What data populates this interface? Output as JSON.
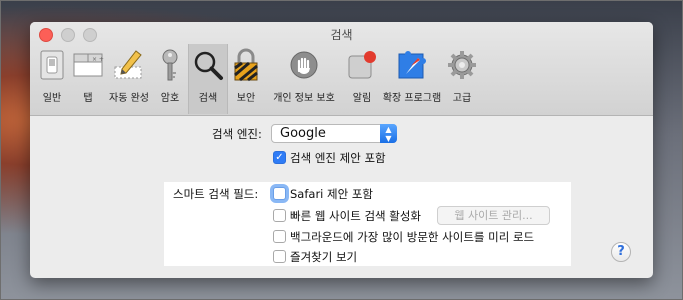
{
  "window": {
    "title": "검색"
  },
  "toolbar": {
    "items": [
      {
        "label": "일반",
        "icon": "general-switch-icon"
      },
      {
        "label": "탭",
        "icon": "tabs-icon"
      },
      {
        "label": "자동 완성",
        "icon": "pencil-form-icon"
      },
      {
        "label": "암호",
        "icon": "key-icon"
      },
      {
        "label": "검색",
        "icon": "magnifier-icon",
        "active": true
      },
      {
        "label": "보안",
        "icon": "padlock-icon"
      },
      {
        "label": "개인 정보 보호",
        "icon": "hand-icon"
      },
      {
        "label": "알림",
        "icon": "notification-badge-icon"
      },
      {
        "label": "확장 프로그램",
        "icon": "puzzle-compass-icon"
      },
      {
        "label": "고급",
        "icon": "gear-icon"
      }
    ]
  },
  "search": {
    "engine_label": "검색 엔진:",
    "engine_value": "Google",
    "include_engine_suggestions": "검색 엔진 제안 포함",
    "smart_field_label": "스마트 검색 필드:",
    "safari_suggestions": "Safari 제안 포함",
    "quick_website_search": "빠른 웹 사이트 검색 활성화",
    "manage_websites_button": "웹 사이트 관리...",
    "preload_top_hit": "백그라운드에 가장 많이 방문한 사이트를 미리 로드",
    "show_favorites": "즐겨찾기 보기",
    "help": "?"
  },
  "colors": {
    "accent": "#2f7cf6",
    "close": "#fc5f57",
    "highlight_bg": "#ffffff"
  }
}
